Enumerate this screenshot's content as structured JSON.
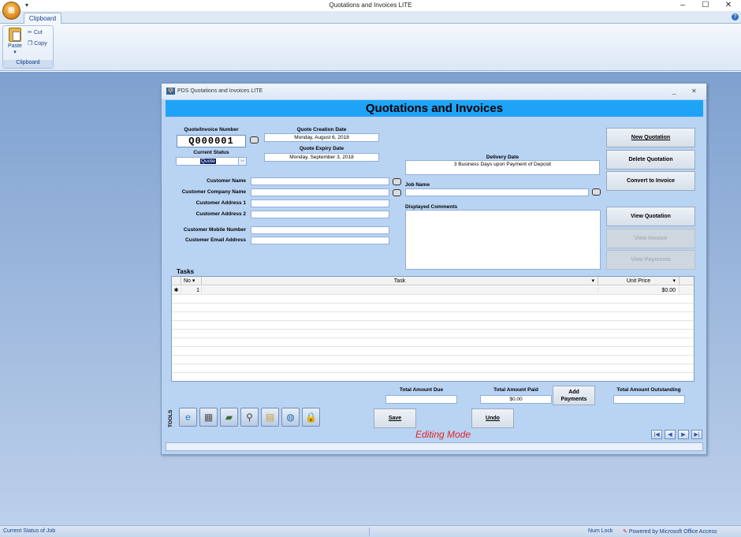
{
  "window": {
    "title": "Quotations and Invoices LITE",
    "controls": [
      "–",
      "☐",
      "✕"
    ]
  },
  "ribbon": {
    "tab": "Clipboard",
    "group": "Clipboard",
    "paste": "Paste",
    "cut": "Cut",
    "copy": "Copy"
  },
  "form": {
    "caption": "PDS Quotations and Invoices LITE",
    "header": "Quotations and Invoices",
    "quote_number_label": "Quote/Invoice Number",
    "quote_number": "Q000001",
    "creation_label": "Quote Creation Date",
    "creation_date": "Monday, August 6, 2018",
    "expiry_label": "Quote Expiry Date",
    "expiry_date": "Monday, September 3, 2018",
    "status_label": "Current Status",
    "status_value": "Quote",
    "delivery_label": "Delivery Date",
    "delivery_value": "3 Business Days upon Payment of Deposit",
    "job_label": "Job Name",
    "job_value": "",
    "comments_label": "Displayed Comments",
    "comments_value": "",
    "customer_fields": [
      {
        "label": "Customer Name",
        "value": ""
      },
      {
        "label": "Customer Company Name",
        "value": ""
      },
      {
        "label": "Customer Address 1",
        "value": ""
      },
      {
        "label": "Customer Address 2",
        "value": ""
      },
      {
        "label": "Customer Mobile Number",
        "value": ""
      },
      {
        "label": "Customer Email Address",
        "value": ""
      }
    ],
    "buttons": {
      "new": "New Quotation",
      "delete": "Delete Quotation",
      "convert": "Convert to Invoice",
      "view_quote": "View Quotation",
      "view_invoice": "View Invoice",
      "view_payments": "View Payments",
      "add_payments": "Add Payments",
      "save": "Save",
      "undo": "Undo"
    },
    "tasks_label": "Tasks",
    "grid": {
      "columns": [
        "No",
        "Task",
        "Unit Price"
      ],
      "row": {
        "marker": "✱",
        "no": "1",
        "task": "",
        "price": "$0.00"
      }
    },
    "totals": {
      "due_label": "Total Amount Due",
      "due": "",
      "paid_label": "Total Amount Paid",
      "paid": "$0.00",
      "outstanding_label": "Total Amount Outstanding",
      "outstanding": ""
    },
    "tools_label": "TOOLS",
    "tool_icons": [
      "internet-explorer-icon",
      "calculator-icon",
      "notes-icon",
      "dictionary-icon",
      "folder-icon",
      "globe-icon",
      "lock-icon"
    ],
    "mode": "Editing Mode"
  },
  "status": {
    "left": "Current Status of Job",
    "numlock": "Num Lock",
    "powered": "Powered by Microsoft Office Access"
  }
}
